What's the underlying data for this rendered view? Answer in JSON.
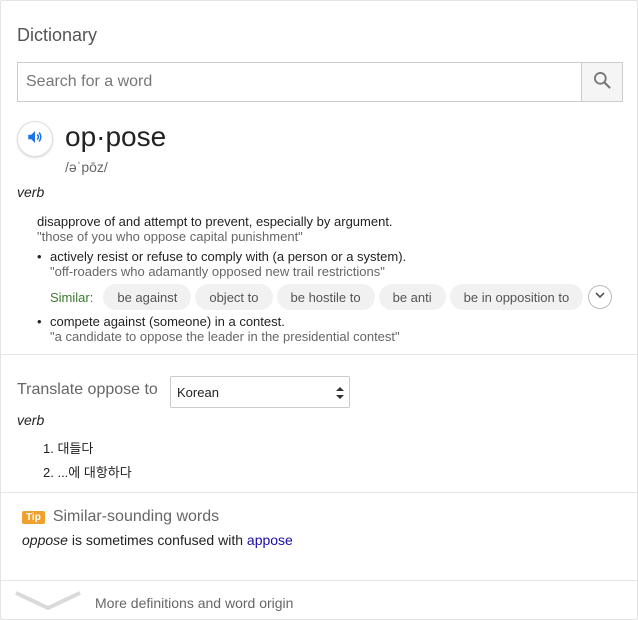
{
  "title": "Dictionary",
  "search": {
    "placeholder": "Search for a word",
    "value": ""
  },
  "entry": {
    "word": "op·pose",
    "pronunciation": "/əˈpōz/",
    "part_of_speech": "verb",
    "senses": [
      {
        "definition": "disapprove of and attempt to prevent, especially by argument.",
        "example": "\"those of you who oppose capital punishment\""
      },
      {
        "definition": "actively resist or refuse to comply with (a person or a system).",
        "example": "\"off-roaders who adamantly opposed new trail restrictions\""
      },
      {
        "definition": "compete against (someone) in a contest.",
        "example": "\"a candidate to oppose the leader in the presidential contest\""
      }
    ],
    "similar": {
      "label": "Similar:",
      "words": [
        "be against",
        "object to",
        "be hostile to",
        "be anti",
        "be in opposition to"
      ]
    }
  },
  "translate": {
    "label": "Translate oppose to",
    "language": "Korean",
    "part_of_speech": "verb",
    "items": [
      "1. 대들다",
      "2. ...에 대항하다"
    ]
  },
  "tip": {
    "badge": "Tip",
    "title": "Similar-sounding words",
    "word": "oppose",
    "text": " is sometimes confused with ",
    "link": "appose"
  },
  "more": {
    "label": "More definitions and word origin"
  },
  "colors": {
    "similar_label": "#3b7a30",
    "link": "#1a0dab",
    "tip_badge": "#f0a02e",
    "speaker": "#1a73e8"
  }
}
